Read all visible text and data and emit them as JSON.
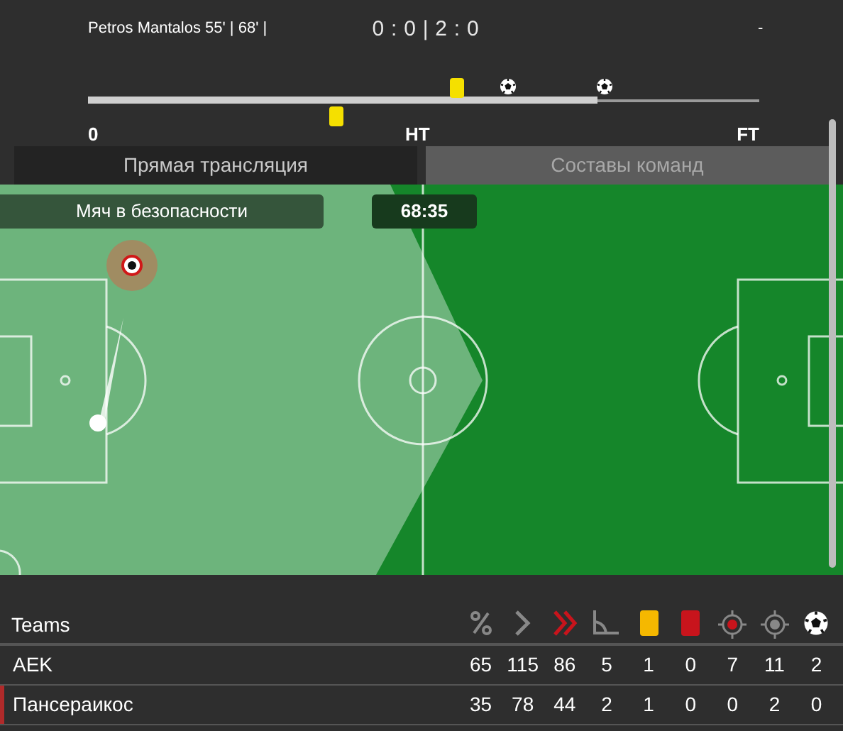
{
  "header": {
    "scorer": "Petros Mantalos 55' | 68' |",
    "score": "0 : 0 | 2 : 0",
    "away_scorer": "-"
  },
  "timeline": {
    "level": 0.76,
    "labels": [
      "0",
      "HT",
      "FT"
    ],
    "events": [
      {
        "kind": "card"
      },
      {
        "kind": "goal"
      },
      {
        "kind": "goal"
      },
      {
        "kind": "card"
      }
    ]
  },
  "tabs": [
    {
      "label": "Прямая трансляция",
      "selected": true
    },
    {
      "label": "Составы команд",
      "selected": false
    }
  ],
  "pitch": {
    "status": "Мяч в безопасности",
    "clock": "68:35"
  },
  "stats": {
    "header": "Teams",
    "rows": [
      {
        "team": "AEK",
        "selected": false,
        "values": [
          "65",
          "115",
          "86",
          "5",
          "1",
          "0",
          "7",
          "11",
          "2"
        ]
      },
      {
        "team": "Пансераикос",
        "selected": true,
        "values": [
          "35",
          "78",
          "44",
          "2",
          "1",
          "0",
          "0",
          "2",
          "0"
        ]
      }
    ]
  }
}
